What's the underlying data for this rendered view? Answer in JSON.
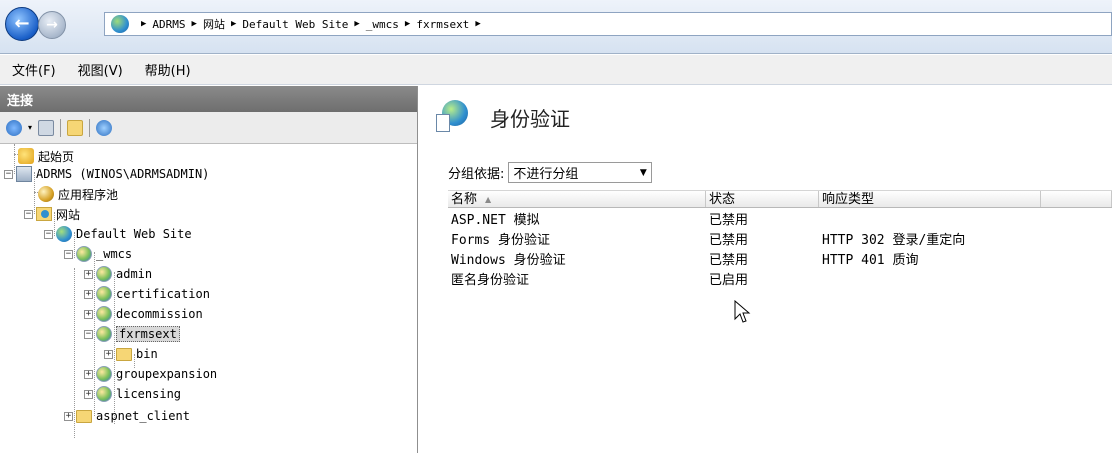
{
  "address_bar": {
    "crumbs": [
      "ADRMS",
      "网站",
      "Default Web Site",
      "_wmcs",
      "fxrmsext"
    ]
  },
  "menu": [
    "文件(F)",
    "视图(V)",
    "帮助(H)"
  ],
  "left_pane": {
    "title": "连接",
    "tree": {
      "start_page": "起始页",
      "server": "ADRMS (WINOS\\ADRMSADMIN)",
      "app_pools": "应用程序池",
      "sites": "网站",
      "default_site": "Default Web Site",
      "wmcs": "_wmcs",
      "admin": "admin",
      "certification": "certification",
      "decommission": "decommission",
      "fxrmsext": "fxrmsext",
      "bin": "bin",
      "groupexpansion": "groupexpansion",
      "licensing": "licensing",
      "aspnet_client": "aspnet_client"
    }
  },
  "right_pane": {
    "title": "身份验证",
    "group_label": "分组依据:",
    "group_value": "不进行分组",
    "columns": [
      "名称",
      "状态",
      "响应类型"
    ],
    "rows": [
      {
        "name": "ASP.NET 模拟",
        "status": "已禁用",
        "response": ""
      },
      {
        "name": "Forms 身份验证",
        "status": "已禁用",
        "response": "HTTP 302 登录/重定向"
      },
      {
        "name": "Windows 身份验证",
        "status": "已禁用",
        "response": "HTTP 401 质询"
      },
      {
        "name": "匿名身份验证",
        "status": "已启用",
        "response": ""
      }
    ]
  }
}
